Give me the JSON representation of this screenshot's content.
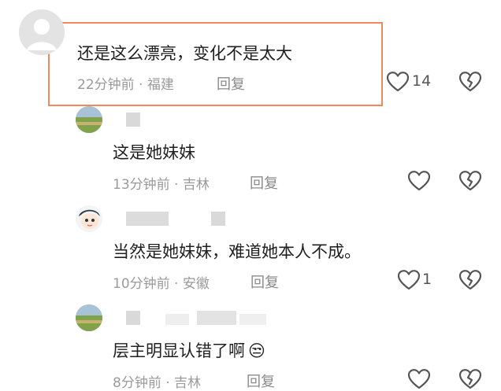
{
  "comments": [
    {
      "text": "还是这么漂亮，变化不是太大",
      "meta": "22分钟前 · 福建",
      "reply_label": "回复",
      "like_count": "14"
    },
    {
      "text": "这是她妹妹",
      "meta": "13分钟前 · 吉林",
      "reply_label": "回复",
      "like_count": ""
    },
    {
      "text": "当然是她妹妹，难道她本人不成。",
      "meta": "10分钟前 · 安徽",
      "reply_label": "回复",
      "like_count": "1"
    },
    {
      "text": "层主明显认错了啊",
      "meta": "8分钟前 · 吉林",
      "reply_label": "回复",
      "like_count": ""
    }
  ],
  "emoji": "😒",
  "colors": {
    "highlight_border": "#f08a5d",
    "meta_text": "#9a9a9a",
    "icon_stroke": "#555555"
  },
  "icons": [
    "default-avatar-icon",
    "heart-icon",
    "broken-heart-icon"
  ]
}
